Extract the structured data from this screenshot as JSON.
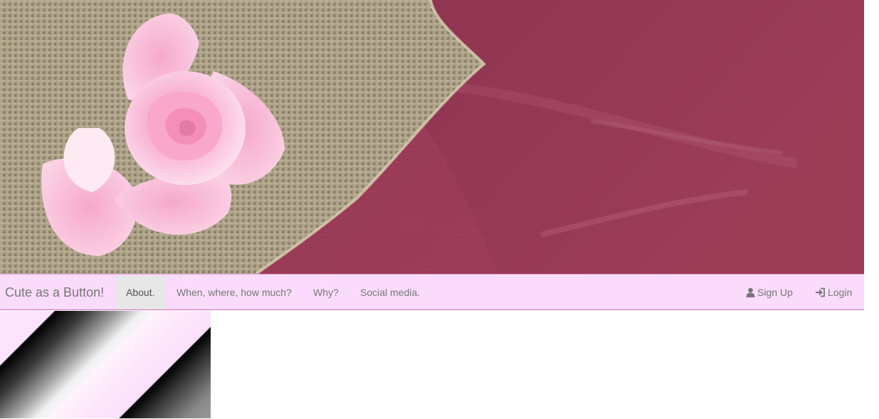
{
  "hero": {
    "image_alt": "pink rose on burlap over pink tulle fabric"
  },
  "navbar": {
    "brand": "Cute as a Button!",
    "items": [
      {
        "label": "About.",
        "active": true
      },
      {
        "label": "When, where, how much?",
        "active": false
      },
      {
        "label": "Why?",
        "active": false
      },
      {
        "label": "Social media.",
        "active": false
      }
    ],
    "right_items": [
      {
        "label": "Sign Up",
        "icon": "user-icon"
      },
      {
        "label": "Login",
        "icon": "login-icon"
      }
    ],
    "colors": {
      "background": "#fbdbfb",
      "text": "#777777",
      "active_bg": "#e7e7e7"
    }
  },
  "decor": {
    "tile_icon": "striped-pattern"
  }
}
